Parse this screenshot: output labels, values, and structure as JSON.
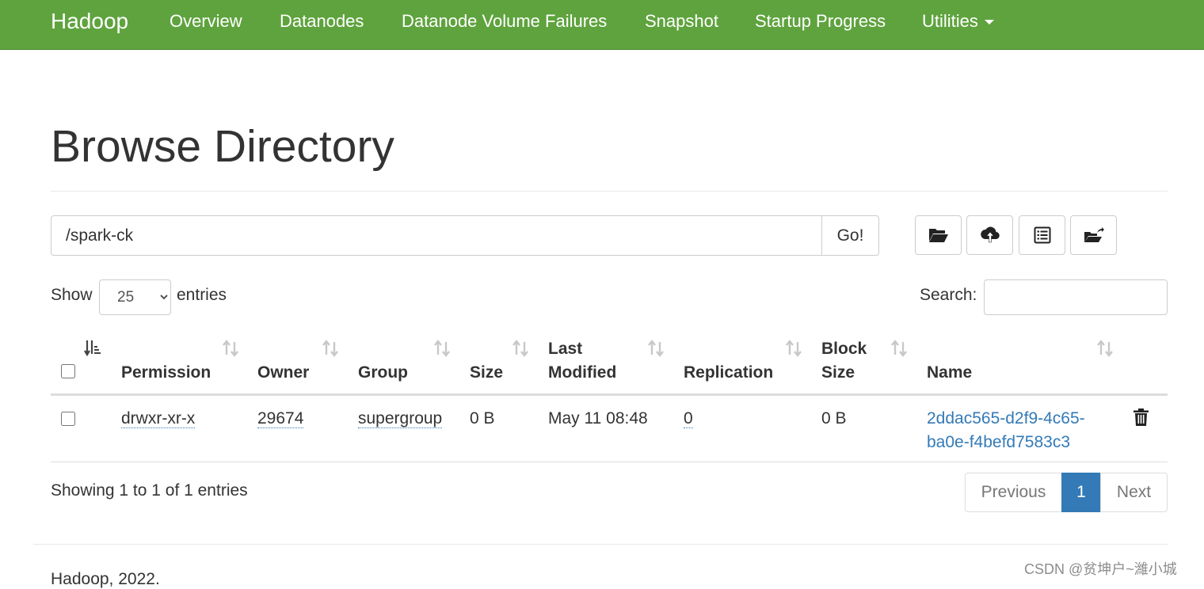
{
  "navbar": {
    "brand": "Hadoop",
    "items": [
      "Overview",
      "Datanodes",
      "Datanode Volume Failures",
      "Snapshot",
      "Startup Progress",
      "Utilities"
    ],
    "color": "#5fa33e"
  },
  "page": {
    "title": "Browse Directory"
  },
  "path_bar": {
    "value": "/spark-ck",
    "go_label": "Go!"
  },
  "toolbar": {
    "icons": [
      "folder-open-icon",
      "cloud-upload-icon",
      "list-alt-icon",
      "folder-move-icon"
    ]
  },
  "entries": {
    "show_label": "Show",
    "selected": "25",
    "options": [
      "25"
    ],
    "suffix": "entries"
  },
  "search": {
    "label": "Search:",
    "value": ""
  },
  "table": {
    "headers": {
      "permission": "Permission",
      "owner": "Owner",
      "group": "Group",
      "size": "Size",
      "last_modified_1": "Last",
      "last_modified_2": "Modified",
      "replication": "Replication",
      "block_size_1": "Block",
      "block_size_2": "Size",
      "name": "Name"
    },
    "rows": [
      {
        "permission": "drwxr-xr-x",
        "owner": "29674",
        "group": "supergroup",
        "size": "0 B",
        "last_modified": "May 11 08:48",
        "replication": "0",
        "block_size": "0 B",
        "name_line1": "2ddac565-d2f9-4c65-",
        "name_line2": "ba0e-f4befd7583c3"
      }
    ]
  },
  "info": "Showing 1 to 1 of 1 entries",
  "pagination": {
    "previous": "Previous",
    "current": "1",
    "next": "Next",
    "active_color": "#337ab7"
  },
  "footer": {
    "text": "Hadoop, 2022."
  },
  "watermark": "CSDN @贫坤户~濰小城"
}
